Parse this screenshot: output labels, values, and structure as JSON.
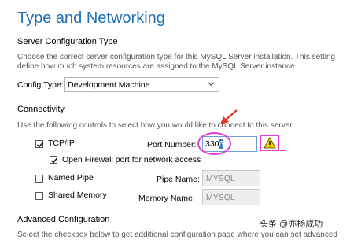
{
  "page": {
    "title": "Type and Networking"
  },
  "server_config": {
    "heading": "Server Configuration Type",
    "description_line1": "Choose the correct server configuration type for this MySQL Server installation. This setting",
    "description_line2": "define how much system resources are assigned to the MySQL Server instance.",
    "config_type_label": "Config Type:",
    "config_type_value": "Development Machine"
  },
  "connectivity": {
    "heading": "Connectivity",
    "description": "Use the following controls to select how you would like to connect to this server.",
    "tcpip": {
      "label": "TCP/IP",
      "checked": true,
      "port_label": "Port Number:",
      "port_value_plain": "330",
      "port_value_selected": "6",
      "firewall_label": "Open Firewall port for network access",
      "firewall_checked": true
    },
    "named_pipe": {
      "label": "Named Pipe",
      "checked": false,
      "pipe_name_label": "Pipe Name:",
      "pipe_name_value": "MYSQL"
    },
    "shared_memory": {
      "label": "Shared Memory",
      "checked": false,
      "memory_name_label": "Memory Name:",
      "memory_name_value": "MYSQL"
    }
  },
  "advanced": {
    "heading": "Advanced Configuration",
    "description": "Select the checkbox below to get additional configuration page where you can set advanced"
  },
  "watermark": {
    "text": "头条 @亦扬成功"
  },
  "colors": {
    "title_blue": "#1e6fb7",
    "annotation_pink": "#e23dd6",
    "annotation_red": "#e8322a",
    "warning_yellow": "#f5d400",
    "selection_blue": "#3f7bc3"
  },
  "icons": {
    "select_arrow": "chevron-down-icon",
    "warning": "warning-triangle-icon",
    "annotation_arrow": "red-arrow-icon"
  }
}
